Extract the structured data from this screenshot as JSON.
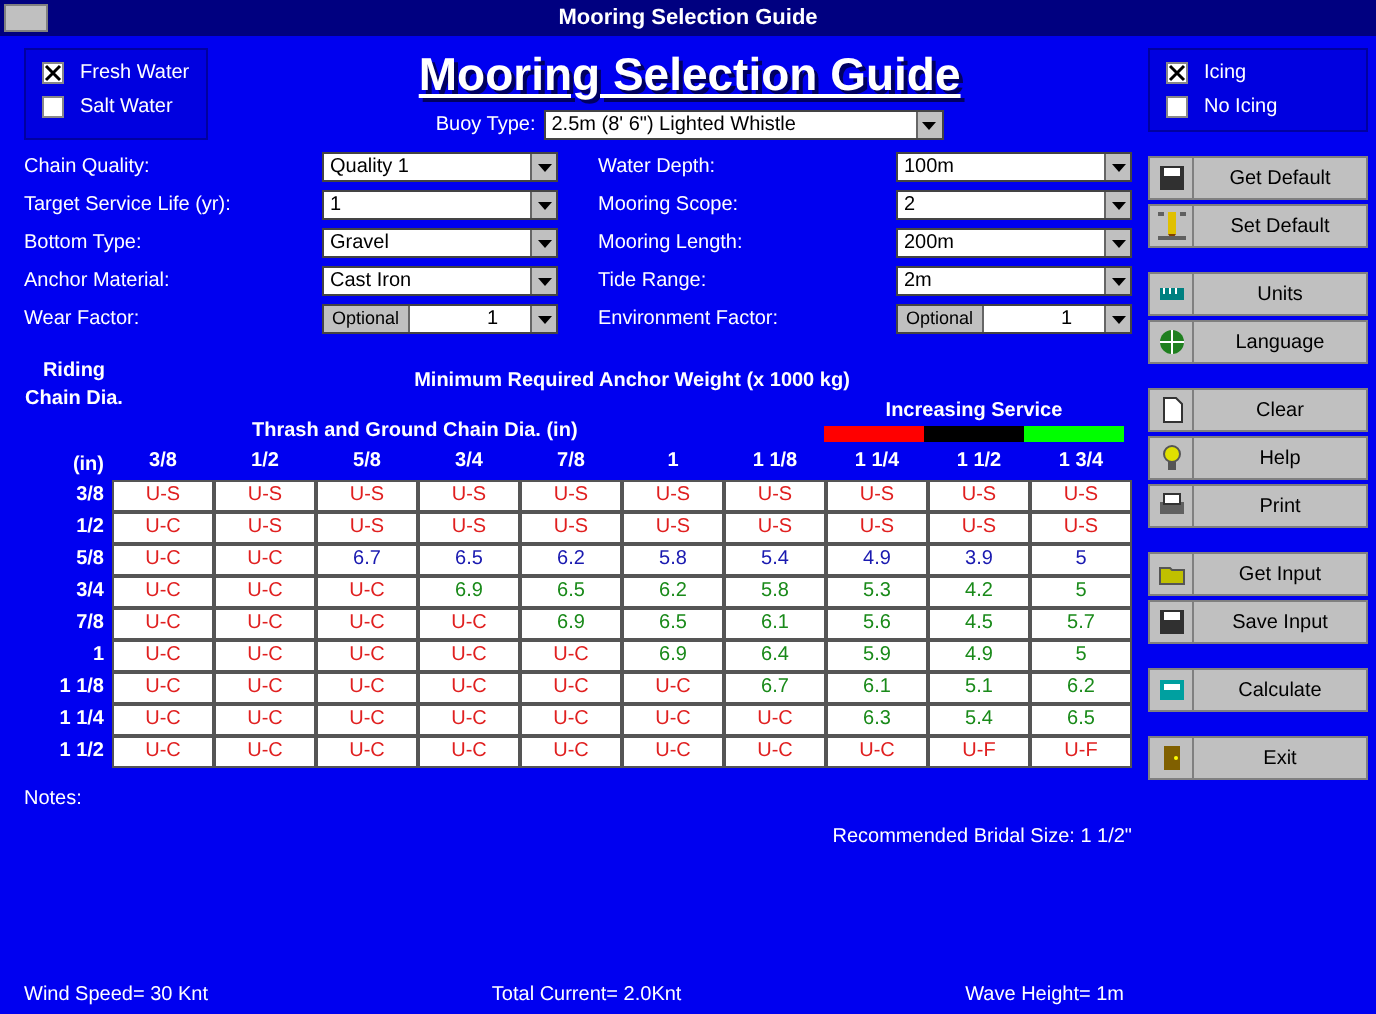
{
  "window": {
    "title": "Mooring Selection Guide"
  },
  "water": [
    {
      "label": "Fresh Water",
      "checked": true
    },
    {
      "label": "Salt Water",
      "checked": false
    }
  ],
  "icing": [
    {
      "label": "Icing",
      "checked": true
    },
    {
      "label": "No Icing",
      "checked": false
    }
  ],
  "heading": "Mooring Selection Guide",
  "buoy": {
    "label": "Buoy Type:",
    "value": "2.5m (8' 6\") Lighted Whistle"
  },
  "fields_left": [
    {
      "label": "Chain Quality:",
      "value": "Quality 1"
    },
    {
      "label": "Target Service Life (yr):",
      "value": "1"
    },
    {
      "label": "Bottom Type:",
      "value": "Gravel"
    },
    {
      "label": "Anchor Material:",
      "value": "Cast Iron"
    },
    {
      "label": "Wear Factor:",
      "option": "Optional",
      "value": "1"
    }
  ],
  "fields_right": [
    {
      "label": "Water Depth:",
      "value": "100m"
    },
    {
      "label": "Mooring Scope:",
      "value": "2"
    },
    {
      "label": "Mooring Length:",
      "value": "200m"
    },
    {
      "label": "Tide Range:",
      "value": "2m"
    },
    {
      "label": "Environment Factor:",
      "option": "Optional",
      "value": "1"
    }
  ],
  "buttons": [
    "Get Default",
    "Set Default",
    "Units",
    "Language",
    "Clear",
    "Help",
    "Print",
    "Get Input",
    "Save Input",
    "Calculate",
    "Exit"
  ],
  "table": {
    "row_header": "Riding Chain Dia.",
    "title": "Minimum Required Anchor Weight  (x 1000 kg)",
    "subtitle": "Thrash and Ground Chain Dia. (in)",
    "legend": {
      "label": "Increasing Service"
    },
    "unit": "(in)",
    "columns": [
      "3/8",
      "1/2",
      "5/8",
      "3/4",
      "7/8",
      "1",
      "1 1/8",
      "1 1/4",
      "1 1/2",
      "1 3/4"
    ],
    "rows": [
      {
        "label": "3/8",
        "cells": [
          {
            "text": "U-S",
            "kind": "fail"
          },
          {
            "text": "U-S",
            "kind": "fail"
          },
          {
            "text": "U-S",
            "kind": "fail"
          },
          {
            "text": "U-S",
            "kind": "fail"
          },
          {
            "text": "U-S",
            "kind": "fail"
          },
          {
            "text": "U-S",
            "kind": "fail"
          },
          {
            "text": "U-S",
            "kind": "fail"
          },
          {
            "text": "U-S",
            "kind": "fail"
          },
          {
            "text": "U-S",
            "kind": "fail"
          },
          {
            "text": "U-S",
            "kind": "fail"
          }
        ]
      },
      {
        "label": "1/2",
        "cells": [
          {
            "text": "U-C",
            "kind": "fail"
          },
          {
            "text": "U-S",
            "kind": "fail"
          },
          {
            "text": "U-S",
            "kind": "fail"
          },
          {
            "text": "U-S",
            "kind": "fail"
          },
          {
            "text": "U-S",
            "kind": "fail"
          },
          {
            "text": "U-S",
            "kind": "fail"
          },
          {
            "text": "U-S",
            "kind": "fail"
          },
          {
            "text": "U-S",
            "kind": "fail"
          },
          {
            "text": "U-S",
            "kind": "fail"
          },
          {
            "text": "U-S",
            "kind": "fail"
          }
        ]
      },
      {
        "label": "5/8",
        "color": "#1a1ab0",
        "cells": [
          {
            "text": "U-C",
            "kind": "fail"
          },
          {
            "text": "U-C",
            "kind": "fail"
          },
          {
            "text": "6.7",
            "kind": "ok"
          },
          {
            "text": "6.5",
            "kind": "ok"
          },
          {
            "text": "6.2",
            "kind": "ok"
          },
          {
            "text": "5.8",
            "kind": "ok"
          },
          {
            "text": "5.4",
            "kind": "ok"
          },
          {
            "text": "4.9",
            "kind": "ok"
          },
          {
            "text": "3.9",
            "kind": "ok"
          },
          {
            "text": "5",
            "kind": "ok"
          }
        ]
      },
      {
        "label": "3/4",
        "color": "#1a8a1a",
        "cells": [
          {
            "text": "U-C",
            "kind": "fail"
          },
          {
            "text": "U-C",
            "kind": "fail"
          },
          {
            "text": "U-C",
            "kind": "fail"
          },
          {
            "text": "6.9",
            "kind": "ok"
          },
          {
            "text": "6.5",
            "kind": "ok"
          },
          {
            "text": "6.2",
            "kind": "ok"
          },
          {
            "text": "5.8",
            "kind": "ok"
          },
          {
            "text": "5.3",
            "kind": "ok"
          },
          {
            "text": "4.2",
            "kind": "ok"
          },
          {
            "text": "5",
            "kind": "ok"
          }
        ]
      },
      {
        "label": "7/8",
        "color": "#1a8a1a",
        "cells": [
          {
            "text": "U-C",
            "kind": "fail"
          },
          {
            "text": "U-C",
            "kind": "fail"
          },
          {
            "text": "U-C",
            "kind": "fail"
          },
          {
            "text": "U-C",
            "kind": "fail"
          },
          {
            "text": "6.9",
            "kind": "ok"
          },
          {
            "text": "6.5",
            "kind": "ok"
          },
          {
            "text": "6.1",
            "kind": "ok"
          },
          {
            "text": "5.6",
            "kind": "ok"
          },
          {
            "text": "4.5",
            "kind": "ok"
          },
          {
            "text": "5.7",
            "kind": "ok"
          }
        ]
      },
      {
        "label": "1",
        "color": "#1a8a1a",
        "cells": [
          {
            "text": "U-C",
            "kind": "fail"
          },
          {
            "text": "U-C",
            "kind": "fail"
          },
          {
            "text": "U-C",
            "kind": "fail"
          },
          {
            "text": "U-C",
            "kind": "fail"
          },
          {
            "text": "U-C",
            "kind": "fail"
          },
          {
            "text": "6.9",
            "kind": "ok"
          },
          {
            "text": "6.4",
            "kind": "ok"
          },
          {
            "text": "5.9",
            "kind": "ok"
          },
          {
            "text": "4.9",
            "kind": "ok"
          },
          {
            "text": "5",
            "kind": "ok"
          }
        ]
      },
      {
        "label": "1 1/8",
        "color": "#1a8a1a",
        "cells": [
          {
            "text": "U-C",
            "kind": "fail"
          },
          {
            "text": "U-C",
            "kind": "fail"
          },
          {
            "text": "U-C",
            "kind": "fail"
          },
          {
            "text": "U-C",
            "kind": "fail"
          },
          {
            "text": "U-C",
            "kind": "fail"
          },
          {
            "text": "U-C",
            "kind": "fail"
          },
          {
            "text": "6.7",
            "kind": "ok"
          },
          {
            "text": "6.1",
            "kind": "ok"
          },
          {
            "text": "5.1",
            "kind": "ok"
          },
          {
            "text": "6.2",
            "kind": "ok"
          }
        ]
      },
      {
        "label": "1 1/4",
        "color": "#1a8a1a",
        "cells": [
          {
            "text": "U-C",
            "kind": "fail"
          },
          {
            "text": "U-C",
            "kind": "fail"
          },
          {
            "text": "U-C",
            "kind": "fail"
          },
          {
            "text": "U-C",
            "kind": "fail"
          },
          {
            "text": "U-C",
            "kind": "fail"
          },
          {
            "text": "U-C",
            "kind": "fail"
          },
          {
            "text": "U-C",
            "kind": "fail"
          },
          {
            "text": "6.3",
            "kind": "ok"
          },
          {
            "text": "5.4",
            "kind": "ok"
          },
          {
            "text": "6.5",
            "kind": "ok"
          }
        ]
      },
      {
        "label": "1 1/2",
        "cells": [
          {
            "text": "U-C",
            "kind": "fail"
          },
          {
            "text": "U-C",
            "kind": "fail"
          },
          {
            "text": "U-C",
            "kind": "fail"
          },
          {
            "text": "U-C",
            "kind": "fail"
          },
          {
            "text": "U-C",
            "kind": "fail"
          },
          {
            "text": "U-C",
            "kind": "fail"
          },
          {
            "text": "U-C",
            "kind": "fail"
          },
          {
            "text": "U-C",
            "kind": "fail"
          },
          {
            "text": "U-F",
            "kind": "fail"
          },
          {
            "text": "U-F",
            "kind": "fail"
          }
        ]
      }
    ]
  },
  "notes_label": "Notes:",
  "bridle": "Recommended Bridal Size: 1 1/2\"",
  "status": [
    "Wind Speed= 30 Knt",
    "Total Current= 2.0Knt",
    "Wave Height= 1m"
  ]
}
